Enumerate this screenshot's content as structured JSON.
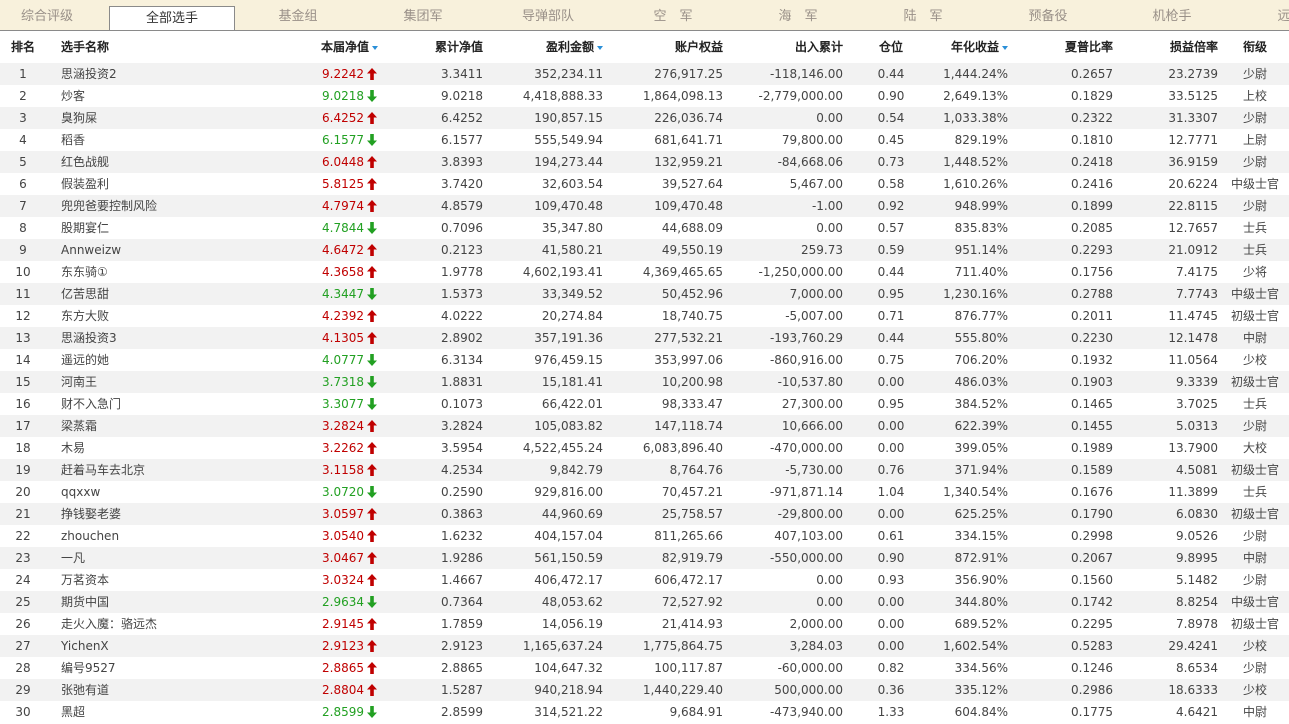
{
  "tabs": [
    {
      "label": "综合评级",
      "active": false
    },
    {
      "label": "全部选手",
      "active": true
    },
    {
      "label": "基金组",
      "active": false
    },
    {
      "label": "集团军",
      "active": false
    },
    {
      "label": "导弹部队",
      "active": false
    },
    {
      "label": "空　军",
      "active": false
    },
    {
      "label": "海　军",
      "active": false
    },
    {
      "label": "陆　军",
      "active": false
    },
    {
      "label": "预备役",
      "active": false
    },
    {
      "label": "机枪手",
      "active": false
    },
    {
      "label": "远",
      "active": false
    }
  ],
  "colors": {
    "up": "#c00000",
    "down": "#22a022",
    "sort_indicator": "#2a8fd8",
    "tab_bar_bg": "#f8f1dc",
    "row_alt_bg": "#f2f2f2"
  },
  "table": {
    "headers": {
      "rank": "排名",
      "name": "选手名称",
      "current_nav": "本届净值",
      "cum_nav": "累计净值",
      "profit": "盈利金额",
      "equity": "账户权益",
      "flow": "出入累计",
      "position": "仓位",
      "annual": "年化收益",
      "sharpe": "夏普比率",
      "pl_ratio": "损益倍率",
      "military_rank": "衔级"
    },
    "sorted_columns": [
      "current_nav",
      "profit",
      "annual"
    ],
    "rows": [
      {
        "rank": "1",
        "name": "思涵投资2",
        "current_nav": "9.2242",
        "trend": "up",
        "cum_nav": "3.3411",
        "profit": "352,234.11",
        "equity": "276,917.25",
        "flow": "-118,146.00",
        "position": "0.44",
        "annual": "1,444.24%",
        "sharpe": "0.2657",
        "pl_ratio": "23.2739",
        "military_rank": "少尉"
      },
      {
        "rank": "2",
        "name": "炒客",
        "current_nav": "9.0218",
        "trend": "down",
        "cum_nav": "9.0218",
        "profit": "4,418,888.33",
        "equity": "1,864,098.13",
        "flow": "-2,779,000.00",
        "position": "0.90",
        "annual": "2,649.13%",
        "sharpe": "0.1829",
        "pl_ratio": "33.5125",
        "military_rank": "上校"
      },
      {
        "rank": "3",
        "name": "臭狗屎",
        "current_nav": "6.4252",
        "trend": "up",
        "cum_nav": "6.4252",
        "profit": "190,857.15",
        "equity": "226,036.74",
        "flow": "0.00",
        "position": "0.54",
        "annual": "1,033.38%",
        "sharpe": "0.2322",
        "pl_ratio": "31.3307",
        "military_rank": "少尉"
      },
      {
        "rank": "4",
        "name": "稻香",
        "current_nav": "6.1577",
        "trend": "down",
        "cum_nav": "6.1577",
        "profit": "555,549.94",
        "equity": "681,641.71",
        "flow": "79,800.00",
        "position": "0.45",
        "annual": "829.19%",
        "sharpe": "0.1810",
        "pl_ratio": "12.7771",
        "military_rank": "上尉"
      },
      {
        "rank": "5",
        "name": "红色战舰",
        "current_nav": "6.0448",
        "trend": "up",
        "cum_nav": "3.8393",
        "profit": "194,273.44",
        "equity": "132,959.21",
        "flow": "-84,668.06",
        "position": "0.73",
        "annual": "1,448.52%",
        "sharpe": "0.2418",
        "pl_ratio": "36.9159",
        "military_rank": "少尉"
      },
      {
        "rank": "6",
        "name": "假装盈利",
        "current_nav": "5.8125",
        "trend": "up",
        "cum_nav": "3.7420",
        "profit": "32,603.54",
        "equity": "39,527.64",
        "flow": "5,467.00",
        "position": "0.58",
        "annual": "1,610.26%",
        "sharpe": "0.2416",
        "pl_ratio": "20.6224",
        "military_rank": "中级士官"
      },
      {
        "rank": "7",
        "name": "兜兜爸要控制风险",
        "current_nav": "4.7974",
        "trend": "up",
        "cum_nav": "4.8579",
        "profit": "109,470.48",
        "equity": "109,470.48",
        "flow": "-1.00",
        "position": "0.92",
        "annual": "948.99%",
        "sharpe": "0.1899",
        "pl_ratio": "22.8115",
        "military_rank": "少尉"
      },
      {
        "rank": "8",
        "name": "股期宴仁",
        "current_nav": "4.7844",
        "trend": "down",
        "cum_nav": "0.7096",
        "profit": "35,347.80",
        "equity": "44,688.09",
        "flow": "0.00",
        "position": "0.57",
        "annual": "835.83%",
        "sharpe": "0.2085",
        "pl_ratio": "12.7657",
        "military_rank": "士兵"
      },
      {
        "rank": "9",
        "name": "Annweizw",
        "current_nav": "4.6472",
        "trend": "up",
        "cum_nav": "0.2123",
        "profit": "41,580.21",
        "equity": "49,550.19",
        "flow": "259.73",
        "position": "0.59",
        "annual": "951.14%",
        "sharpe": "0.2293",
        "pl_ratio": "21.0912",
        "military_rank": "士兵"
      },
      {
        "rank": "10",
        "name": "东东骑①",
        "current_nav": "4.3658",
        "trend": "up",
        "cum_nav": "1.9778",
        "profit": "4,602,193.41",
        "equity": "4,369,465.65",
        "flow": "-1,250,000.00",
        "position": "0.44",
        "annual": "711.40%",
        "sharpe": "0.1756",
        "pl_ratio": "7.4175",
        "military_rank": "少将"
      },
      {
        "rank": "11",
        "name": "亿苦思甜",
        "current_nav": "4.3447",
        "trend": "down",
        "cum_nav": "1.5373",
        "profit": "33,349.52",
        "equity": "50,452.96",
        "flow": "7,000.00",
        "position": "0.95",
        "annual": "1,230.16%",
        "sharpe": "0.2788",
        "pl_ratio": "7.7743",
        "military_rank": "中级士官"
      },
      {
        "rank": "12",
        "name": "东方大败",
        "current_nav": "4.2392",
        "trend": "up",
        "cum_nav": "4.0222",
        "profit": "20,274.84",
        "equity": "18,740.75",
        "flow": "-5,007.00",
        "position": "0.71",
        "annual": "876.77%",
        "sharpe": "0.2011",
        "pl_ratio": "11.4745",
        "military_rank": "初级士官"
      },
      {
        "rank": "13",
        "name": "思涵投资3",
        "current_nav": "4.1305",
        "trend": "up",
        "cum_nav": "2.8902",
        "profit": "357,191.36",
        "equity": "277,532.21",
        "flow": "-193,760.29",
        "position": "0.44",
        "annual": "555.80%",
        "sharpe": "0.2230",
        "pl_ratio": "12.1478",
        "military_rank": "中尉"
      },
      {
        "rank": "14",
        "name": "遥远的她",
        "current_nav": "4.0777",
        "trend": "down",
        "cum_nav": "6.3134",
        "profit": "976,459.15",
        "equity": "353,997.06",
        "flow": "-860,916.00",
        "position": "0.75",
        "annual": "706.20%",
        "sharpe": "0.1932",
        "pl_ratio": "11.0564",
        "military_rank": "少校"
      },
      {
        "rank": "15",
        "name": "河南王",
        "current_nav": "3.7318",
        "trend": "down",
        "cum_nav": "1.8831",
        "profit": "15,181.41",
        "equity": "10,200.98",
        "flow": "-10,537.80",
        "position": "0.00",
        "annual": "486.03%",
        "sharpe": "0.1903",
        "pl_ratio": "9.3339",
        "military_rank": "初级士官"
      },
      {
        "rank": "16",
        "name": "财不入急门",
        "current_nav": "3.3077",
        "trend": "down",
        "cum_nav": "0.1073",
        "profit": "66,422.01",
        "equity": "98,333.47",
        "flow": "27,300.00",
        "position": "0.95",
        "annual": "384.52%",
        "sharpe": "0.1465",
        "pl_ratio": "3.7025",
        "military_rank": "士兵"
      },
      {
        "rank": "17",
        "name": "梁蒸霜",
        "current_nav": "3.2824",
        "trend": "up",
        "cum_nav": "3.2824",
        "profit": "105,083.82",
        "equity": "147,118.74",
        "flow": "10,666.00",
        "position": "0.00",
        "annual": "622.39%",
        "sharpe": "0.1455",
        "pl_ratio": "5.0313",
        "military_rank": "少尉"
      },
      {
        "rank": "18",
        "name": "木易",
        "current_nav": "3.2262",
        "trend": "up",
        "cum_nav": "3.5954",
        "profit": "4,522,455.24",
        "equity": "6,083,896.40",
        "flow": "-470,000.00",
        "position": "0.00",
        "annual": "399.05%",
        "sharpe": "0.1989",
        "pl_ratio": "13.7900",
        "military_rank": "大校"
      },
      {
        "rank": "19",
        "name": "赶着马车去北京",
        "current_nav": "3.1158",
        "trend": "up",
        "cum_nav": "4.2534",
        "profit": "9,842.79",
        "equity": "8,764.76",
        "flow": "-5,730.00",
        "position": "0.76",
        "annual": "371.94%",
        "sharpe": "0.1589",
        "pl_ratio": "4.5081",
        "military_rank": "初级士官"
      },
      {
        "rank": "20",
        "name": "qqxxw",
        "current_nav": "3.0720",
        "trend": "down",
        "cum_nav": "0.2590",
        "profit": "929,816.00",
        "equity": "70,457.21",
        "flow": "-971,871.14",
        "position": "1.04",
        "annual": "1,340.54%",
        "sharpe": "0.1676",
        "pl_ratio": "11.3899",
        "military_rank": "士兵"
      },
      {
        "rank": "21",
        "name": "挣钱娶老婆",
        "current_nav": "3.0597",
        "trend": "up",
        "cum_nav": "0.3863",
        "profit": "44,960.69",
        "equity": "25,758.57",
        "flow": "-29,800.00",
        "position": "0.00",
        "annual": "625.25%",
        "sharpe": "0.1790",
        "pl_ratio": "6.0830",
        "military_rank": "初级士官"
      },
      {
        "rank": "22",
        "name": "zhouchen",
        "current_nav": "3.0540",
        "trend": "up",
        "cum_nav": "1.6232",
        "profit": "404,157.04",
        "equity": "811,265.66",
        "flow": "407,103.00",
        "position": "0.61",
        "annual": "334.15%",
        "sharpe": "0.2998",
        "pl_ratio": "9.0526",
        "military_rank": "少尉"
      },
      {
        "rank": "23",
        "name": "一凡",
        "current_nav": "3.0467",
        "trend": "up",
        "cum_nav": "1.9286",
        "profit": "561,150.59",
        "equity": "82,919.79",
        "flow": "-550,000.00",
        "position": "0.90",
        "annual": "872.91%",
        "sharpe": "0.2067",
        "pl_ratio": "9.8995",
        "military_rank": "中尉"
      },
      {
        "rank": "24",
        "name": "万茗资本",
        "current_nav": "3.0324",
        "trend": "up",
        "cum_nav": "1.4667",
        "profit": "406,472.17",
        "equity": "606,472.17",
        "flow": "0.00",
        "position": "0.93",
        "annual": "356.90%",
        "sharpe": "0.1560",
        "pl_ratio": "5.1482",
        "military_rank": "少尉"
      },
      {
        "rank": "25",
        "name": "期货中国",
        "current_nav": "2.9634",
        "trend": "down",
        "cum_nav": "0.7364",
        "profit": "48,053.62",
        "equity": "72,527.92",
        "flow": "0.00",
        "position": "0.00",
        "annual": "344.80%",
        "sharpe": "0.1742",
        "pl_ratio": "8.8254",
        "military_rank": "中级士官"
      },
      {
        "rank": "26",
        "name": "走火入魔：骆远杰",
        "current_nav": "2.9145",
        "trend": "up",
        "cum_nav": "1.7859",
        "profit": "14,056.19",
        "equity": "21,414.93",
        "flow": "2,000.00",
        "position": "0.00",
        "annual": "689.52%",
        "sharpe": "0.2295",
        "pl_ratio": "7.8978",
        "military_rank": "初级士官"
      },
      {
        "rank": "27",
        "name": "YichenX",
        "current_nav": "2.9123",
        "trend": "up",
        "cum_nav": "2.9123",
        "profit": "1,165,637.24",
        "equity": "1,775,864.75",
        "flow": "3,284.03",
        "position": "0.00",
        "annual": "1,602.54%",
        "sharpe": "0.5283",
        "pl_ratio": "29.4241",
        "military_rank": "少校"
      },
      {
        "rank": "28",
        "name": "编号9527",
        "current_nav": "2.8865",
        "trend": "up",
        "cum_nav": "2.8865",
        "profit": "104,647.32",
        "equity": "100,117.87",
        "flow": "-60,000.00",
        "position": "0.82",
        "annual": "334.56%",
        "sharpe": "0.1246",
        "pl_ratio": "8.6534",
        "military_rank": "少尉"
      },
      {
        "rank": "29",
        "name": "张弛有道",
        "current_nav": "2.8804",
        "trend": "up",
        "cum_nav": "1.5287",
        "profit": "940,218.94",
        "equity": "1,440,229.40",
        "flow": "500,000.00",
        "position": "0.36",
        "annual": "335.12%",
        "sharpe": "0.2986",
        "pl_ratio": "18.6333",
        "military_rank": "少校"
      },
      {
        "rank": "30",
        "name": "黑超",
        "current_nav": "2.8599",
        "trend": "down",
        "cum_nav": "2.8599",
        "profit": "314,521.22",
        "equity": "9,684.91",
        "flow": "-473,940.00",
        "position": "1.33",
        "annual": "604.84%",
        "sharpe": "0.1775",
        "pl_ratio": "4.6421",
        "military_rank": "中尉"
      }
    ]
  }
}
